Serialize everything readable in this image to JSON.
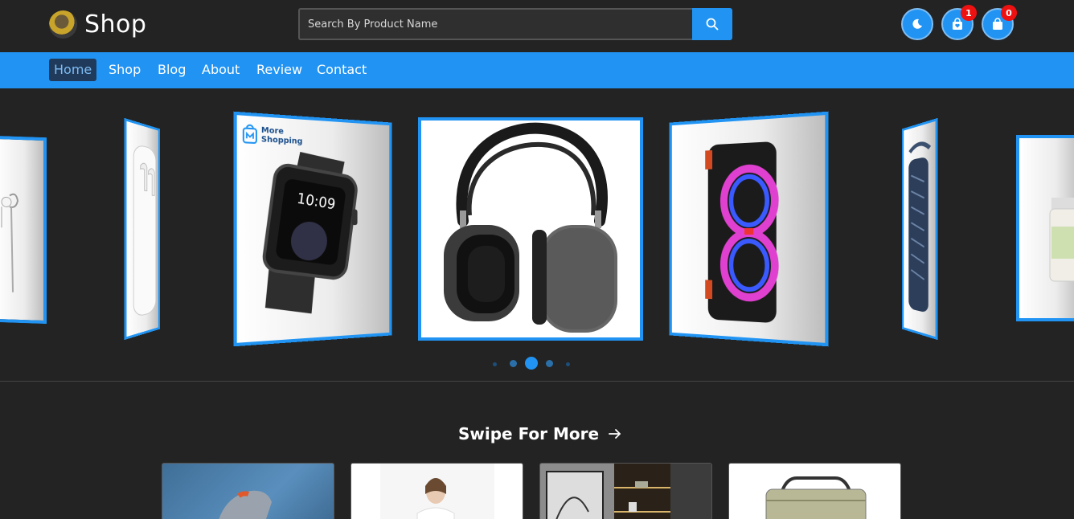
{
  "header": {
    "logo_text": "Shop",
    "search_placeholder": "Search By Product Name",
    "wishlist_count": "1",
    "cart_count": "0"
  },
  "nav": {
    "items": [
      {
        "label": "Home"
      },
      {
        "label": "Shop"
      },
      {
        "label": "Blog"
      },
      {
        "label": "About"
      },
      {
        "label": "Review"
      },
      {
        "label": "Contact"
      }
    ],
    "active": "Home"
  },
  "carousel": {
    "slides": [
      "earphones",
      "airpods",
      "smartwatch",
      "headphones",
      "speaker",
      "portable-speaker",
      "jar"
    ],
    "watch_brand": "More Shopping",
    "watch_time": "10:09",
    "active_index": 2,
    "dot_count": 5
  },
  "section": {
    "swipe_label": "Swipe For More"
  },
  "colors": {
    "accent": "#2194f3",
    "background": "#232323",
    "badge": "#ee1111"
  }
}
